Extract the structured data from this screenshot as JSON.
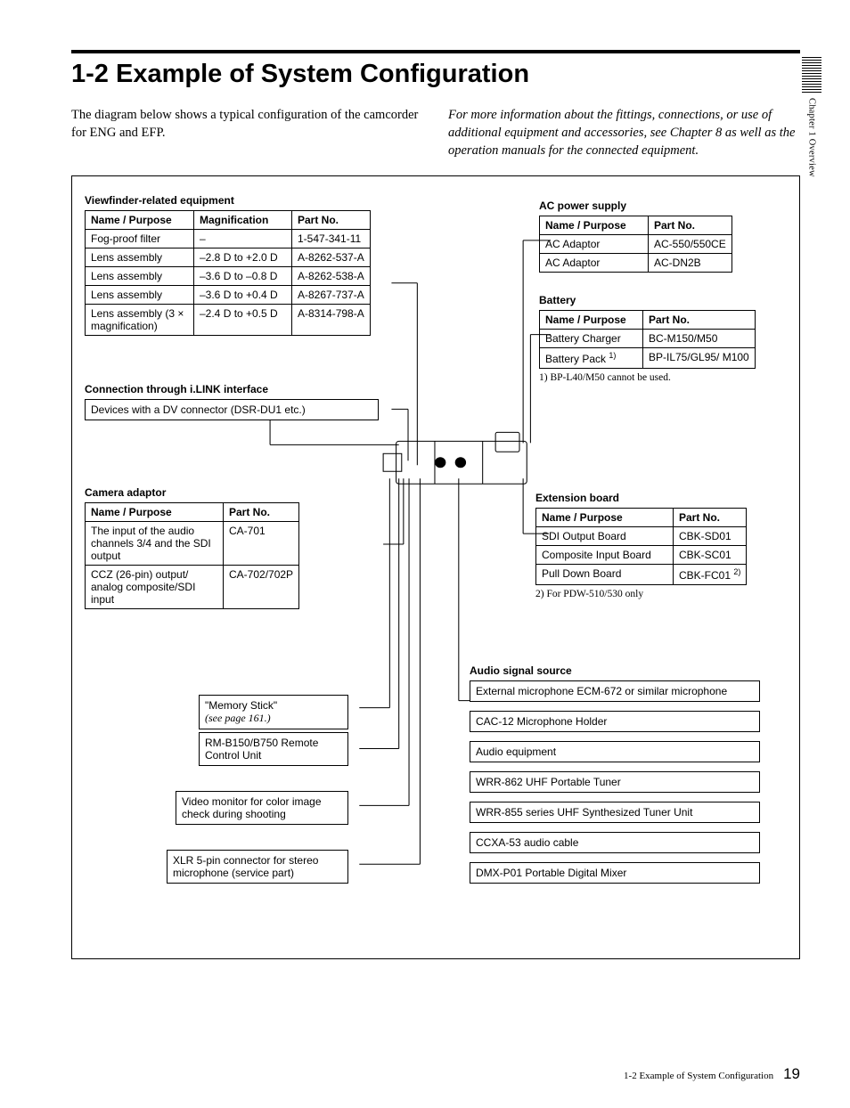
{
  "side_tab": "Chapter 1  Overview",
  "title": "1-2  Example of System Configuration",
  "intro_left": "The diagram below shows a typical configuration of the camcorder for ENG and EFP.",
  "intro_right": "For more information about the fittings, connections, or use of additional equipment and accessories, see Chapter 8 as well as the operation manuals for the connected equipment.",
  "viewfinder": {
    "title": "Viewfinder-related equipment",
    "headers": [
      "Name / Purpose",
      "Magnification",
      "Part No."
    ],
    "rows": [
      [
        "Fog-proof filter",
        "–",
        "1-547-341-11"
      ],
      [
        "Lens assembly",
        "–2.8 D to +2.0 D",
        "A-8262-537-A"
      ],
      [
        "Lens assembly",
        "–3.6 D to –0.8 D",
        "A-8262-538-A"
      ],
      [
        "Lens assembly",
        "–3.6 D to +0.4 D",
        "A-8267-737-A"
      ],
      [
        "Lens assembly (3 × magnification)",
        "–2.4 D to +0.5 D",
        "A-8314-798-A"
      ]
    ]
  },
  "ilink": {
    "title": "Connection through i.LINK interface",
    "item": "Devices with a DV connector (DSR-DU1 etc.)"
  },
  "camadapt": {
    "title": "Camera adaptor",
    "headers": [
      "Name / Purpose",
      "Part No."
    ],
    "rows": [
      [
        "The input of the audio channels 3/4 and the SDI output",
        "CA-701"
      ],
      [
        "CCZ (26-pin) output/ analog composite/SDI input",
        "CA-702/702P"
      ]
    ]
  },
  "memstick": {
    "line1": "\"Memory Stick\"",
    "line2": "(see page 161.)"
  },
  "rm": "RM-B150/B750 Remote Control Unit",
  "monitor": "Video monitor for color image check during shooting",
  "xlr": "XLR 5-pin connector for stereo microphone (service part)",
  "acpower": {
    "title": "AC power supply",
    "headers": [
      "Name / Purpose",
      "Part No."
    ],
    "rows": [
      [
        "AC Adaptor",
        "AC-550/550CE"
      ],
      [
        "AC Adaptor",
        "AC-DN2B"
      ]
    ]
  },
  "battery": {
    "title": "Battery",
    "headers": [
      "Name / Purpose",
      "Part No."
    ],
    "rows": [
      [
        "Battery Charger",
        "BC-M150/M50"
      ],
      [
        "Battery Pack",
        "BP-IL75/GL95/ M100"
      ]
    ],
    "sup_mark": "1)",
    "note": "1) BP-L40/M50 cannot be used."
  },
  "ext": {
    "title": "Extension board",
    "headers": [
      "Name / Purpose",
      "Part No."
    ],
    "rows": [
      [
        "SDI Output Board",
        "CBK-SD01"
      ],
      [
        "Composite Input Board",
        "CBK-SC01"
      ],
      [
        "Pull Down Board",
        "CBK-FC01"
      ]
    ],
    "sup_mark": "2)",
    "note": "2) For PDW-510/530 only"
  },
  "audio": {
    "title": "Audio signal source",
    "items": [
      "External microphone ECM-672 or similar microphone",
      "CAC-12 Microphone Holder",
      "Audio equipment",
      "WRR-862 UHF Portable Tuner",
      "WRR-855 series UHF Synthesized Tuner Unit",
      "CCXA-53 audio cable",
      "DMX-P01 Portable Digital Mixer"
    ]
  },
  "footer_section": "1-2 Example of System Configuration",
  "footer_page": "19"
}
